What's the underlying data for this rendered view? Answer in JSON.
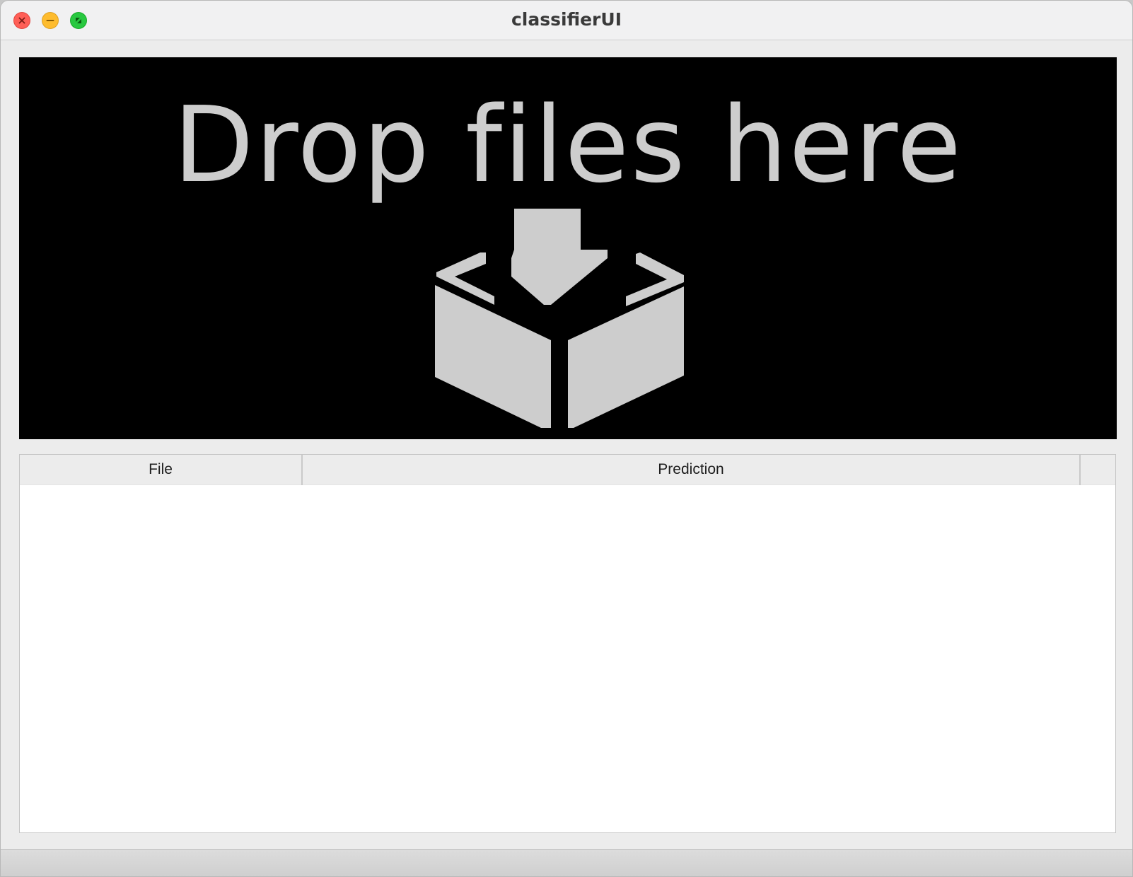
{
  "window": {
    "title": "classifierUI"
  },
  "dropzone": {
    "text": "Drop files here",
    "icon": "inbox-download-icon",
    "background_color": "#000000",
    "foreground_color": "#cdcdcd"
  },
  "table": {
    "columns": [
      {
        "label": "File"
      },
      {
        "label": "Prediction"
      },
      {
        "label": ""
      }
    ],
    "rows": []
  },
  "traffic_lights": {
    "close_color": "#ff5f57",
    "minimize_color": "#febc2e",
    "maximize_color": "#28c840"
  }
}
